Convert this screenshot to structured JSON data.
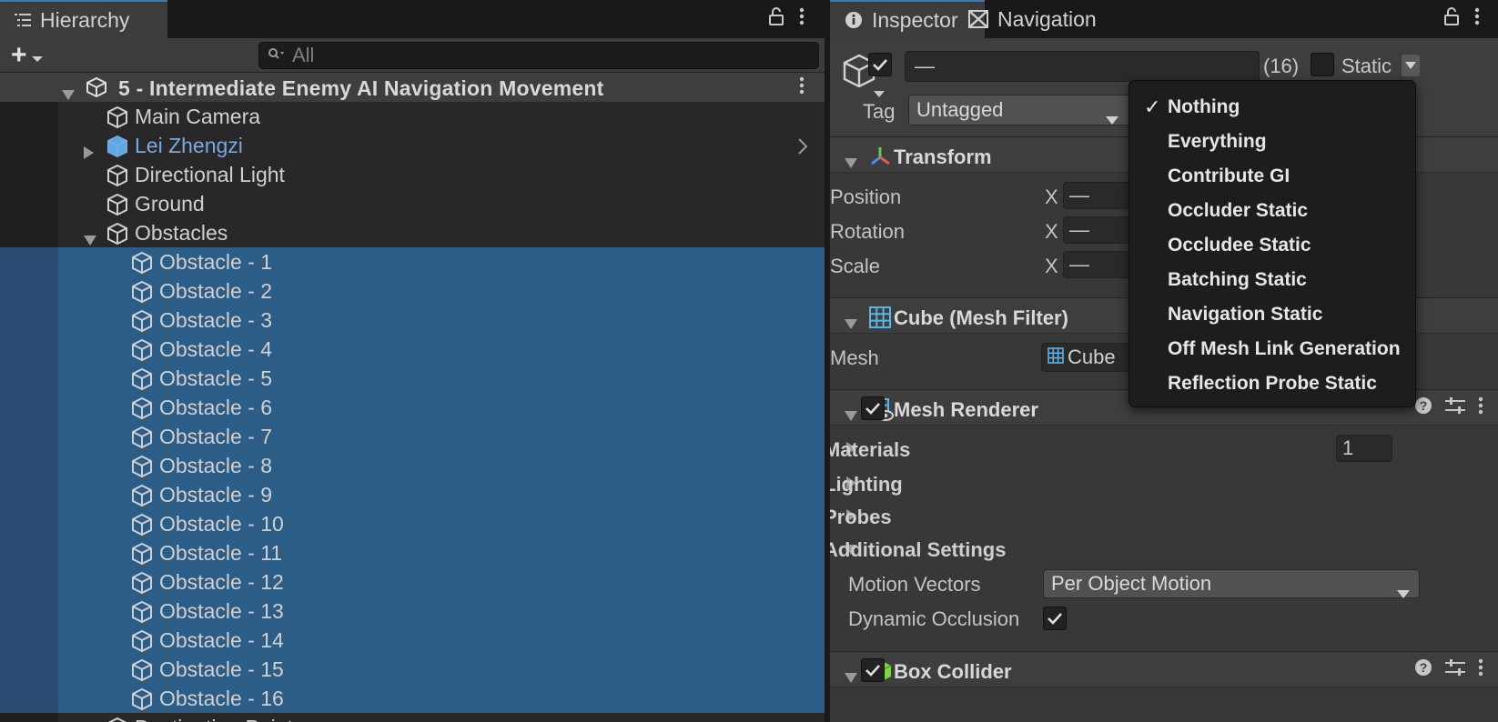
{
  "hierarchy": {
    "tab_title": "Hierarchy",
    "add_label": "+",
    "search_placeholder": "All",
    "scene_name": "5 - Intermediate Enemy AI Navigation Movement",
    "items": [
      {
        "name": "Main Camera",
        "depth": 1,
        "selected": false
      },
      {
        "name": "Lei Zhengzi",
        "depth": 1,
        "selected": false,
        "prefab": true,
        "collapsed": true
      },
      {
        "name": "Directional Light",
        "depth": 1,
        "selected": false
      },
      {
        "name": "Ground",
        "depth": 1,
        "selected": false
      },
      {
        "name": "Obstacles",
        "depth": 1,
        "selected": false,
        "expanded": true
      },
      {
        "name": "Obstacle - 1",
        "depth": 2,
        "selected": true
      },
      {
        "name": "Obstacle - 2",
        "depth": 2,
        "selected": true
      },
      {
        "name": "Obstacle - 3",
        "depth": 2,
        "selected": true
      },
      {
        "name": "Obstacle - 4",
        "depth": 2,
        "selected": true
      },
      {
        "name": "Obstacle - 5",
        "depth": 2,
        "selected": true
      },
      {
        "name": "Obstacle - 6",
        "depth": 2,
        "selected": true
      },
      {
        "name": "Obstacle - 7",
        "depth": 2,
        "selected": true
      },
      {
        "name": "Obstacle - 8",
        "depth": 2,
        "selected": true
      },
      {
        "name": "Obstacle - 9",
        "depth": 2,
        "selected": true
      },
      {
        "name": "Obstacle - 10",
        "depth": 2,
        "selected": true
      },
      {
        "name": "Obstacle - 11",
        "depth": 2,
        "selected": true
      },
      {
        "name": "Obstacle - 12",
        "depth": 2,
        "selected": true
      },
      {
        "name": "Obstacle - 13",
        "depth": 2,
        "selected": true
      },
      {
        "name": "Obstacle - 14",
        "depth": 2,
        "selected": true
      },
      {
        "name": "Obstacle - 15",
        "depth": 2,
        "selected": true
      },
      {
        "name": "Obstacle - 16",
        "depth": 2,
        "selected": true
      },
      {
        "name": "Destination Points",
        "depth": 1,
        "selected": false,
        "collapsed": true
      }
    ]
  },
  "inspector": {
    "tabs": {
      "inspector": "Inspector",
      "navigation": "Navigation"
    },
    "object_name": "—",
    "count": "(16)",
    "static_label": "Static",
    "tag_label": "Tag",
    "tag_value": "Untagged",
    "transform": {
      "title": "Transform",
      "position_label": "Position",
      "rotation_label": "Rotation",
      "scale_label": "Scale",
      "axis_x": "X",
      "mixed": "—"
    },
    "mesh_filter": {
      "title": "Cube (Mesh Filter)",
      "mesh_label": "Mesh",
      "mesh_value": "Cube"
    },
    "mesh_renderer": {
      "title": "Mesh Renderer",
      "materials_label": "Materials",
      "materials_count": "1",
      "lighting_label": "Lighting",
      "probes_label": "Probes",
      "additional_label": "Additional Settings",
      "motion_vectors_label": "Motion Vectors",
      "motion_vectors_value": "Per Object Motion",
      "dynamic_occlusion_label": "Dynamic Occlusion"
    },
    "box_collider": {
      "title": "Box Collider"
    }
  },
  "static_menu": {
    "items": [
      {
        "label": "Nothing",
        "checked": true
      },
      {
        "label": "Everything",
        "checked": false
      },
      {
        "label": "Contribute GI",
        "checked": false
      },
      {
        "label": "Occluder Static",
        "checked": false
      },
      {
        "label": "Occludee Static",
        "checked": false
      },
      {
        "label": "Batching Static",
        "checked": false
      },
      {
        "label": "Navigation Static",
        "checked": false
      },
      {
        "label": "Off Mesh Link Generation",
        "checked": false
      },
      {
        "label": "Reflection Probe Static",
        "checked": false
      }
    ],
    "check_glyph": "✓"
  },
  "colors": {
    "selection": "#2c5d87",
    "prefab_text": "#7ba8e0",
    "tab_accent": "#3a79bb",
    "transform_icon": [
      "#e65a4a",
      "#6bc35a",
      "#4a8fe6"
    ],
    "mesh_icon": "#5ab4e6",
    "collider_icon": "#7dd64a"
  }
}
